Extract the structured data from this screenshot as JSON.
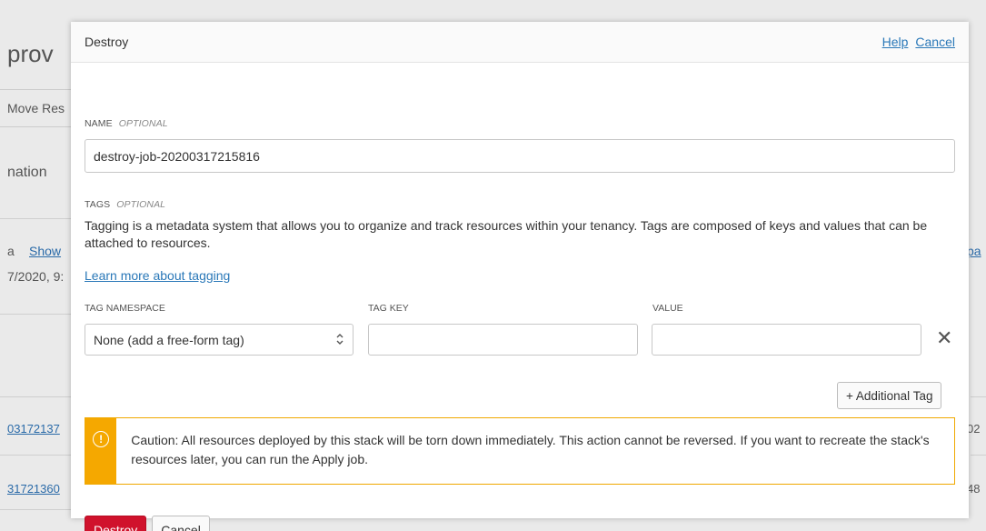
{
  "background": {
    "title": "prov",
    "move_button": "Move Res",
    "tab": "nation",
    "meta_prefix": "a",
    "show_link": "Show",
    "date": "7/2020, 9:",
    "job_id_1": "03172137",
    "job_id_2": "31721360",
    "right_1": "pa",
    "right_2": "02",
    "right_3": "48"
  },
  "modal": {
    "title": "Destroy",
    "help_link": "Help",
    "cancel_link": "Cancel",
    "name": {
      "label": "NAME",
      "optional": "OPTIONAL",
      "value": "destroy-job-20200317215816"
    },
    "tags": {
      "label": "TAGS",
      "optional": "OPTIONAL",
      "description": "Tagging is a metadata system that allows you to organize and track resources within your tenancy. Tags are composed of keys and values that can be attached to resources.",
      "learn_more": "Learn more about tagging",
      "namespace_label": "TAG NAMESPACE",
      "key_label": "TAG KEY",
      "value_label": "VALUE",
      "namespace_value": "None (add a free-form tag)",
      "key_value": "",
      "value_value": "",
      "remove_glyph": "✕",
      "add_button": "+ Additional Tag"
    },
    "caution": {
      "icon": "!",
      "text": "Caution: All resources deployed by this stack will be torn down immediately. This action cannot be reversed. If you want to recreate the stack's resources later, you can run the Apply job."
    },
    "footer": {
      "destroy_button": "Destroy",
      "cancel_button": "Cancel"
    }
  },
  "colors": {
    "primary_danger": "#d0122c",
    "warning": "#f5a800",
    "link": "#2a78b8"
  }
}
